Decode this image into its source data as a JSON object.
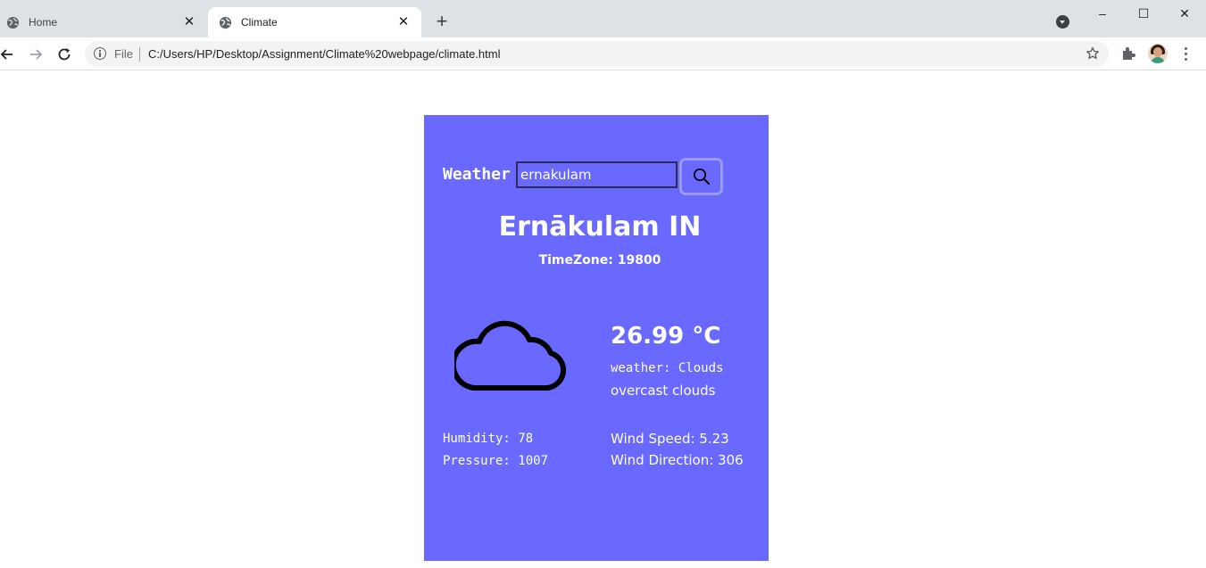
{
  "browser": {
    "tabs": [
      {
        "title": "Home",
        "active": false
      },
      {
        "title": "Climate",
        "active": true
      }
    ],
    "new_tab": "+",
    "address_bar": {
      "scheme_label": "File",
      "url": "C:/Users/HP/Desktop/Assignment/Climate%20webpage/climate.html"
    },
    "window_controls": {
      "minimize": "–",
      "maximize": "☐",
      "close": "✕"
    },
    "tab_close": "✕"
  },
  "weather_app": {
    "brand": "Weather",
    "search_value": "ernakulam",
    "city": "Ernākulam IN",
    "timezone": "TimeZone: 19800",
    "icon": "cloud-icon",
    "temperature": "26.99 °C",
    "weather_main": "weather: Clouds",
    "description": "overcast clouds",
    "humidity": "Humidity: 78",
    "pressure": "Pressure: 1007",
    "wind_speed": "Wind Speed: 5.23",
    "wind_direction": "Wind Direction: 306"
  },
  "colors": {
    "card_background": "#6969ff",
    "tab_strip": "#dee1e6",
    "text": "#ffffff"
  }
}
